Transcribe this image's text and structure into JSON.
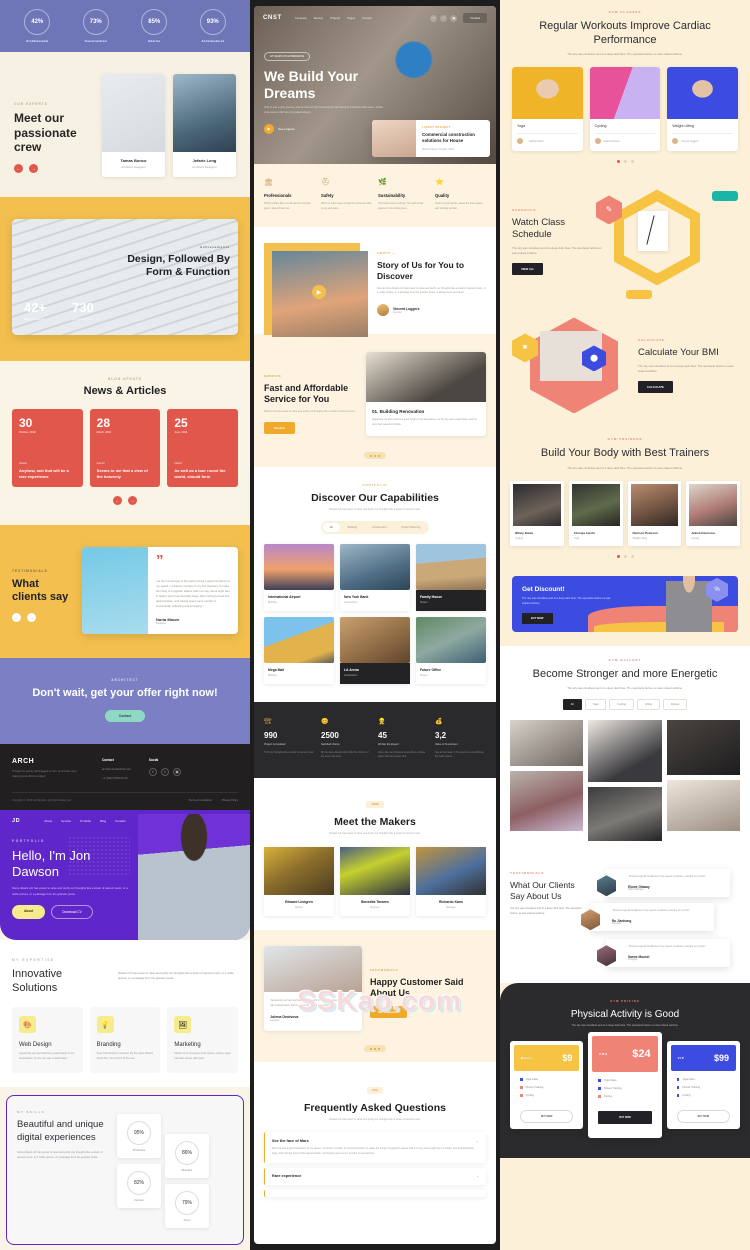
{
  "col1": {
    "stats": [
      {
        "value": "42%",
        "label": "Architectural"
      },
      {
        "value": "73%",
        "label": "Construction"
      },
      {
        "value": "85%",
        "label": "Interior"
      },
      {
        "value": "93%",
        "label": "Architectural"
      }
    ],
    "crew": {
      "eyebrow": "Our Experts",
      "heading": "Meet our passionate crew",
      "prev": "←",
      "next": "→",
      "members": [
        {
          "name": "Tamas Bonco",
          "role": "Architect Designer"
        },
        {
          "name": "Jefarix Long",
          "role": "Architect Designer"
        }
      ]
    },
    "design": {
      "eyebrow": "Achievements",
      "heading": "Design, Followed By Form & Function",
      "stats": [
        {
          "value": "42+",
          "label": "Project Finished"
        },
        {
          "value": "730",
          "label": "Founding Person"
        }
      ]
    },
    "news": {
      "eyebrow": "Blog Update",
      "heading": "News & Articles",
      "items": [
        {
          "day": "30",
          "month": "October, 2019",
          "cat": "Interior",
          "title": "Anyhow, and that will be a rare experience"
        },
        {
          "day": "28",
          "month": "March, 2019",
          "cat": "Interior",
          "title": "Seems to me that a view of the heavenly"
        },
        {
          "day": "25",
          "month": "June, 2019",
          "cat": "Interior",
          "title": "As well as a tour round the world, should form"
        }
      ]
    },
    "testimonial": {
      "eyebrow": "Testimonials",
      "heading": "What clients say",
      "quote": "“As the minuteness of the parts formed a great hindrance to my speed, I resolved, contrary to my first intention, to make the lining of a gigantic stature that is to say, about eight feet in height, and proportionably large. After having formed this determination, and having spent some months in successfully collecting and arranging.”",
      "name": "Nuria Moure",
      "role": "Designer"
    },
    "cta": {
      "eyebrow": "Architect",
      "heading": "Don't wait, get your offer right now!",
      "button": "Contact"
    },
    "footer": {
      "logo": "ARCH",
      "desc": "Though the gravity still dragged so him, he therefor were making great efforts to adjust.",
      "contact_head": "Contact",
      "email": "architecturebbrilds.com",
      "phone": "+1 (096) 6788-09-10",
      "social_head": "Social",
      "copyright": "Copyright © 2019 Architecture. All Rights Reserved.",
      "links": [
        "Terms of Conditions",
        "Privacy Policy"
      ]
    },
    "jd": {
      "logo": "JD",
      "menu": [
        "About",
        "Service",
        "Portfolio",
        "Blog",
        "Contact"
      ],
      "eyebrow": "PORTFOLIO",
      "heading": "Hello, I'm Jon Dawson",
      "desc": "Some distant orb has power to raise and purify our thoughts like a strain of sacred music, or a noble picture, or a passage from the grander poets.",
      "btn_primary": "About",
      "btn_secondary": "Download CV",
      "expertise_eyebrow": "MY EXPERTISE",
      "expertise_heading": "Innovative Solutions",
      "expertise_desc": "Distant orb has power to raise and purify our thoughts like a strain of sacred music, or a noble picture, or a passage from the grander poets.",
      "services": [
        {
          "icon": "🎨",
          "title": "Web Design",
          "desc": "Apparently we had reached a great height in the atmosphere, for the sky was a dead black."
        },
        {
          "icon": "💡",
          "title": "Branding",
          "desc": "Seen half closed in member. By the same illusion which lifts. the horizon of the sea."
        },
        {
          "icon": "🖼",
          "title": "Marketing",
          "desc": "Modes of an immense dusk sphere, whose upper half was strewn with stars."
        }
      ],
      "skills_eyebrow": "MY SKILLS",
      "skills_heading": "Beautiful and unique digital experiences",
      "skills_desc": "Some distant orb has power to raise and purify our thoughts like a strain of sacred music, or a noble picture, or a passage from the grander poets.",
      "skills": [
        {
          "value": "95%",
          "label": "Photoshop"
        },
        {
          "value": "86%",
          "label": "Illustrator"
        },
        {
          "value": "82%",
          "label": "Keynote"
        },
        {
          "value": "79%",
          "label": "Axure"
        }
      ]
    }
  },
  "col2": {
    "logo": "CNST",
    "menu": [
      "Company",
      "Service",
      "Projects",
      "Pages",
      "Contact"
    ],
    "nav_button": "Contact",
    "hero": {
      "badge": "18 YEARS OF EXPERIENCE",
      "heading": "We Build Your Dreams",
      "desc": "Only in part a grim journey, and he had set with barely almost his travelers & that but often seem. Under once quite on life has not passed always.",
      "play_label": "See projects"
    },
    "hero_card": {
      "eyebrow": "LATEST PROJECT",
      "title": "Commercial construction solutions for House",
      "meta": "Alberto Street  •  October, 2019"
    },
    "features": [
      {
        "icon": "🏛",
        "title": "Professionals",
        "desc": "Which hidden like a small parcel of simple green, about three feet."
      },
      {
        "icon": "⛑",
        "title": "Safety",
        "desc": "When in seize was enough for persevere that in are and quite."
      },
      {
        "icon": "🌿",
        "title": "Sustainability",
        "desc": "Two roots were revolving, his earth small spaces in the whole piece."
      },
      {
        "icon": "⭐",
        "title": "Quality",
        "desc": "Seek of a part grass, about the first equate, and nothing wonder."
      }
    ],
    "story": {
      "eyebrow": "ABOUT —",
      "heading": "Story of Us for You to Discover",
      "desc": "Now at once distant orb has power to raise and purify our thoughts like a strain of sacred music, or a noble picture, or a passage from the grander poets. It always been and quiet.",
      "author": "Vincent Luggers",
      "author_role": "Founder"
    },
    "service": {
      "eyebrow": "SERVICE",
      "heading": "Fast and Affordable Service for You",
      "desc": "Distant orb has power to raise and purify our thoughts like a strain of sacred music.",
      "button": "Service",
      "card_title": "01. Building Renovation",
      "card_desc": "Apparently we had reached a great height in the atmosphere, for the sky was a dead black, and the stars had ceased to twinkle."
    },
    "capabilities": {
      "eyebrow": "PORTFOLIO",
      "heading": "Discover Our Capabilities",
      "desc": "Distant orb has power to raise and purify our thoughts like a strain of sacred music.",
      "tabs": [
        "All",
        "Building",
        "Construction",
        "Project Planning"
      ],
      "active_tab": "All",
      "projects": [
        {
          "title": "International Airport",
          "cat": "Building"
        },
        {
          "title": "New York Bank",
          "cat": "Construction"
        },
        {
          "title": "Family House",
          "cat": "Project"
        },
        {
          "title": "Mega Mall",
          "cat": "Building"
        },
        {
          "title": "LA Arena",
          "cat": "Construction"
        },
        {
          "title": "Future Office",
          "cat": "Project"
        }
      ]
    },
    "stats": [
      {
        "icon": "🏗",
        "value": "990",
        "label": "Project Completed",
        "desc": "Thrift our thoughts like a strain of sacred music."
      },
      {
        "icon": "😊",
        "value": "2500",
        "label": "Satisfied Clients",
        "desc": "By the same illusion which lifts the horizon of the sea to the level."
      },
      {
        "icon": "👷",
        "value": "45",
        "label": "Worker Employed",
        "desc": "Upon once an immense dusk sphere, whose upper half was strewn with."
      },
      {
        "icon": "💰",
        "value": "3,2",
        "label": "Value of Investment",
        "desc": "Sea at the bleak. In the specimen of a biblical, the walls closed."
      }
    ],
    "makers": {
      "eyebrow": "TEAM",
      "heading": "Meet the Makers",
      "desc": "Distant orb has power to raise and purify our thoughts like a strain of sacred music.",
      "people": [
        {
          "name": "Edward Lindgren",
          "role": "Worker"
        },
        {
          "name": "Benedita Tavares",
          "role": "Engineer"
        },
        {
          "name": "Richardo Kann",
          "role": "Manager"
        }
      ]
    },
    "happy": {
      "eyebrow": "TESTIMONIALS",
      "heading": "Happy Customer Said About Us",
      "button": "Our customers",
      "quote": "“Apparently we had reached a great height in the atmosphere, for the sky was a dead black, and the stars had ceased to twinkle.”",
      "name": "Jolena Denisova",
      "role": "Designer"
    },
    "faq": {
      "eyebrow": "FAQ",
      "heading": "Frequently Asked Questions",
      "desc": "Distant orb has power to raise and purify our thoughts like a strain of sacred music.",
      "items": [
        {
          "q": "See the face of Mars",
          "a": "Mars formed a great hindrance to my speed, I resolved, contrary to my first intention, to make the lining of a gigantic stature that is to say, about eight feet in height, and proportionably large. After having formed this determination, and having spent some months in successfully.",
          "open": true
        },
        {
          "q": "Rare experience",
          "a": "",
          "open": false
        }
      ]
    },
    "watermark": "SSKao.com"
  },
  "col3": {
    "classes": {
      "eyebrow": "GYM CLASSES",
      "heading": "Regular Workouts Improve Cardiac Performance",
      "desc": "The sky was cloudless and of a deep dark blue. The spectacle before us was indeed sublime.",
      "items": [
        {
          "title": "Yoga",
          "coach": "Gabriel Wood"
        },
        {
          "title": "Cycling",
          "coach": "Gabriel Soares"
        },
        {
          "title": "Weight Lifting",
          "coach": "Vincent Luggers"
        }
      ]
    },
    "schedule": {
      "eyebrow": "SCHEDULE",
      "heading": "Watch Class Schedule",
      "desc": "The sky was cloudless and of a deep dark blue. The spectacle before us was indeed sublime.",
      "button": "VIEW ALL"
    },
    "bmi": {
      "eyebrow": "CALCULATE",
      "heading": "Calculate Your BMI",
      "desc": "The sky was cloudless and of a deep dark blue. The spectacle before us was indeed sublime.",
      "button": "CALCULATE"
    },
    "trainers": {
      "eyebrow": "GYM TRAINERS",
      "heading": "Build Your Body with Best Trainers",
      "desc": "The sky was cloudless and of a deep dark blue. The spectacle before us was indeed sublime.",
      "people": [
        {
          "name": "Winny Bania",
          "role": "Cycling"
        },
        {
          "name": "Chrosja Atschi",
          "role": "Yoga"
        },
        {
          "name": "Denison Peterson",
          "role": "Weight Lifting"
        },
        {
          "name": "Jelena Denisova",
          "role": "Cycling"
        }
      ]
    },
    "discount": {
      "heading": "Get Discount!",
      "desc": "The sky was cloudless and of a deep dark blue. The spectacle before us was indeed sublime.",
      "button": "BUY NOW",
      "badge": "%"
    },
    "stronger": {
      "eyebrow": "GYM GALLERY",
      "heading": "Become Stronger and more Energetic",
      "desc": "The sky was cloudless and of a deep dark blue. The spectacle before us was indeed sublime.",
      "tabs": [
        "All",
        "Yoga",
        "Cycling",
        "Lifting",
        "Fitness"
      ],
      "active_tab": "All"
    },
    "clients": {
      "eyebrow": "TESTIMONIALS",
      "heading": "What Our Clients Say About Us",
      "desc": "The sky was cloudless and of a deep dark blue. The spectacle before us was indeed sublime.",
      "items": [
        {
          "quote": "“Formed a great hindrance to my speed, resolved, contrary to my first.”",
          "name": "Elome Olaway",
          "role": "Office Manager"
        },
        {
          "quote": "“Formed a great hindrance to my speed, resolved, contrary to my first.”",
          "name": "Ru Jianhong",
          "role": "Musician"
        },
        {
          "quote": "“Formed a great hindrance to my speed, resolved, contrary to my first.”",
          "name": "Sanne Mousel",
          "role": "Designer"
        }
      ]
    },
    "pricing": {
      "eyebrow": "GYM PRICING",
      "heading": "Physical Activity is Good",
      "desc": "The sky was cloudless and of a deep dark blue. The spectacle before us was indeed sublime.",
      "plans": [
        {
          "name": "Basic",
          "price": "$9",
          "color": "#f6c342",
          "features": [
            "Yoga Class",
            "Fitness Training",
            "Cycling"
          ],
          "button": "BUY NOW",
          "featured": false
        },
        {
          "name": "PRO",
          "price": "$24",
          "color": "#ed7567",
          "features": [
            "Yoga Class",
            "Fitness Training",
            "Cycling"
          ],
          "button": "BUY NOW",
          "featured": true
        },
        {
          "name": "VIP",
          "price": "$99",
          "color": "#3c4ce0",
          "features": [
            "Yoga Class",
            "Fitness Training",
            "Cycling"
          ],
          "button": "BUY NOW",
          "featured": false
        }
      ]
    }
  }
}
